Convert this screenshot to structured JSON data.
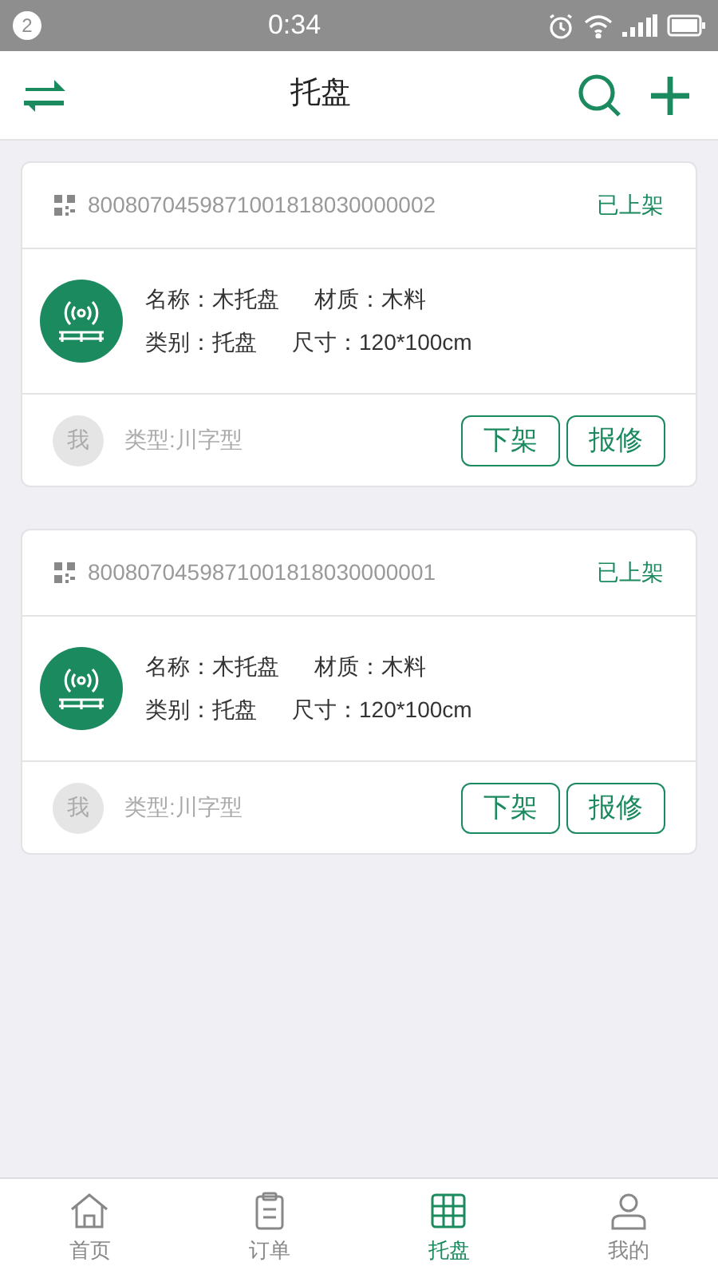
{
  "status_bar": {
    "notification_count": "2",
    "time": "0:34"
  },
  "header": {
    "title": "托盘"
  },
  "cards": [
    {
      "code": "8008070459871001818030000002",
      "status": "已上架",
      "fields": [
        [
          {
            "label": "名称：",
            "value": "木托盘"
          },
          {
            "label": "材质：",
            "value": "木料"
          }
        ],
        [
          {
            "label": "类别：",
            "value": "托盘"
          },
          {
            "label": "尺寸：",
            "value": "120*100cm"
          }
        ]
      ],
      "avatar": "我",
      "type": "类型:川字型",
      "buttons": [
        "下架",
        "报修"
      ]
    },
    {
      "code": "8008070459871001818030000001",
      "status": "已上架",
      "fields": [
        [
          {
            "label": "名称：",
            "value": "木托盘"
          },
          {
            "label": "材质：",
            "value": "木料"
          }
        ],
        [
          {
            "label": "类别：",
            "value": "托盘"
          },
          {
            "label": "尺寸：",
            "value": "120*100cm"
          }
        ]
      ],
      "avatar": "我",
      "type": "类型:川字型",
      "buttons": [
        "下架",
        "报修"
      ]
    }
  ],
  "tabs": [
    {
      "label": "首页",
      "kind": "home",
      "selected": false
    },
    {
      "label": "订单",
      "kind": "orders",
      "selected": false
    },
    {
      "label": "托盘",
      "kind": "pallet",
      "selected": true
    },
    {
      "label": "我的",
      "kind": "profile",
      "selected": false
    }
  ]
}
